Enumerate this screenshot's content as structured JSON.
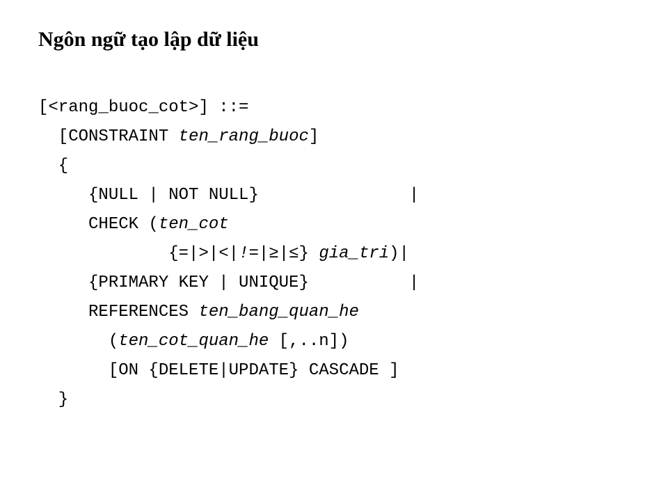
{
  "title": "Ngôn ngữ tạo lập dữ liệu",
  "code": {
    "l1_a": "[<rang_buoc_cot>] ::=",
    "l2_a": "  [CONSTRAINT ",
    "l2_b": "ten_rang_buoc",
    "l2_c": "]",
    "l3_a": "  {",
    "l4_a": "     {NULL | NOT NULL}               |",
    "l5_a": "     CHECK (",
    "l5_b": "ten_cot",
    "l6_a": "             {",
    "l6_b": "=",
    "l6_c": "|",
    "l6_d": ">",
    "l6_e": "|",
    "l6_f": "<",
    "l6_g": "|",
    "l6_h": "!=",
    "l6_i": "|",
    "l6_j": "≥",
    "l6_k": "|",
    "l6_l": "≤",
    "l6_m": "} ",
    "l6_n": "gia_tri",
    "l6_o": ")|",
    "l7_a": "     {PRIMARY KEY | UNIQUE}          |",
    "l8_a": "     REFERENCES ",
    "l8_b": "ten_bang_quan_he",
    "l9_a": "       (",
    "l9_b": "ten_cot_quan_he",
    "l9_c": " [,..n])",
    "l10_a": "       [ON {DELETE|UPDATE} CASCADE ]",
    "l11_a": "  }"
  }
}
